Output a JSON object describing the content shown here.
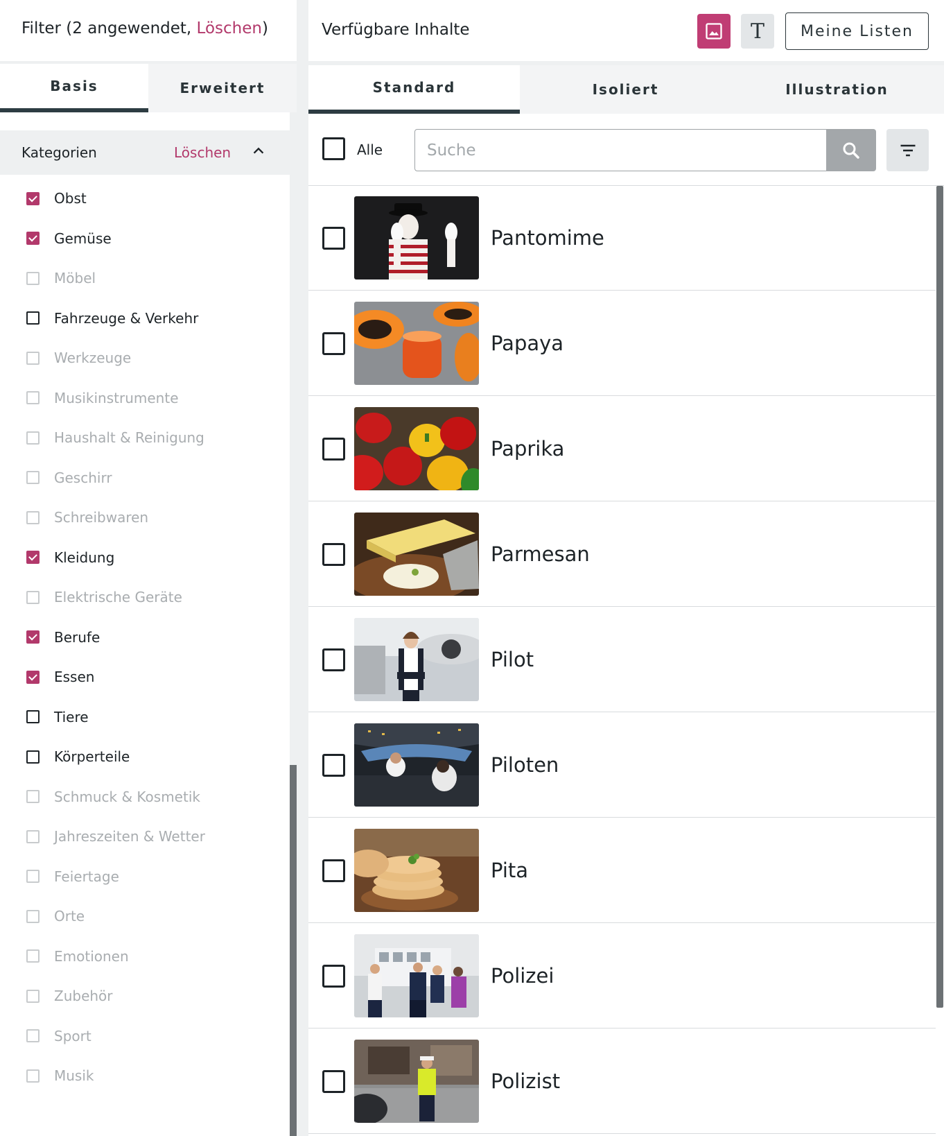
{
  "filter": {
    "title_prefix": "Filter (2 angewendet, ",
    "clear_label": "Löschen",
    "title_suffix": ")"
  },
  "left_tabs": [
    {
      "label": "Basis",
      "active": true
    },
    {
      "label": "Erweitert",
      "active": false
    }
  ],
  "categories": {
    "title": "Kategorien",
    "clear_label": "Löschen",
    "items": [
      {
        "label": "Obst",
        "state": "checked"
      },
      {
        "label": "Gemüse",
        "state": "checked"
      },
      {
        "label": "Möbel",
        "state": "disabled"
      },
      {
        "label": "Fahrzeuge & Verkehr",
        "state": "unchecked"
      },
      {
        "label": "Werkzeuge",
        "state": "disabled"
      },
      {
        "label": "Musikinstrumente",
        "state": "disabled"
      },
      {
        "label": "Haushalt & Reinigung",
        "state": "disabled"
      },
      {
        "label": "Geschirr",
        "state": "disabled"
      },
      {
        "label": "Schreibwaren",
        "state": "disabled"
      },
      {
        "label": "Kleidung",
        "state": "checked"
      },
      {
        "label": "Elektrische Geräte",
        "state": "disabled"
      },
      {
        "label": "Berufe",
        "state": "checked"
      },
      {
        "label": "Essen",
        "state": "checked"
      },
      {
        "label": "Tiere",
        "state": "unchecked"
      },
      {
        "label": "Körperteile",
        "state": "unchecked"
      },
      {
        "label": "Schmuck & Kosmetik",
        "state": "disabled"
      },
      {
        "label": "Jahreszeiten & Wetter",
        "state": "disabled"
      },
      {
        "label": "Feiertage",
        "state": "disabled"
      },
      {
        "label": "Orte",
        "state": "disabled"
      },
      {
        "label": "Emotionen",
        "state": "disabled"
      },
      {
        "label": "Zubehör",
        "state": "disabled"
      },
      {
        "label": "Sport",
        "state": "disabled"
      },
      {
        "label": "Musik",
        "state": "disabled"
      }
    ]
  },
  "content": {
    "title": "Verfügbare Inhalte",
    "image_mode_icon": "image-icon",
    "text_mode_icon": "text-T-icon",
    "text_mode_glyph": "T",
    "my_lists_label": "Meine Listen"
  },
  "right_tabs": [
    {
      "label": "Standard",
      "active": true
    },
    {
      "label": "Isoliert",
      "active": false
    },
    {
      "label": "Illustration",
      "active": false
    }
  ],
  "toolbar": {
    "all_label": "Alle",
    "search_placeholder": "Suche",
    "search_icon": "search-icon",
    "sort_icon": "filter-lines-icon"
  },
  "items": [
    {
      "label": "Pantomime",
      "thumb": "mime"
    },
    {
      "label": "Papaya",
      "thumb": "papaya"
    },
    {
      "label": "Paprika",
      "thumb": "paprika"
    },
    {
      "label": "Parmesan",
      "thumb": "parmesan"
    },
    {
      "label": "Pilot",
      "thumb": "pilot"
    },
    {
      "label": "Piloten",
      "thumb": "cockpit"
    },
    {
      "label": "Pita",
      "thumb": "pita"
    },
    {
      "label": "Polizei",
      "thumb": "police"
    },
    {
      "label": "Polizist",
      "thumb": "policeman"
    }
  ],
  "colors": {
    "accent": "#b2396b",
    "image_mode_bg": "#c03d74",
    "tab_indicator": "#2d3c42",
    "disabled_text": "#a9adb0"
  }
}
